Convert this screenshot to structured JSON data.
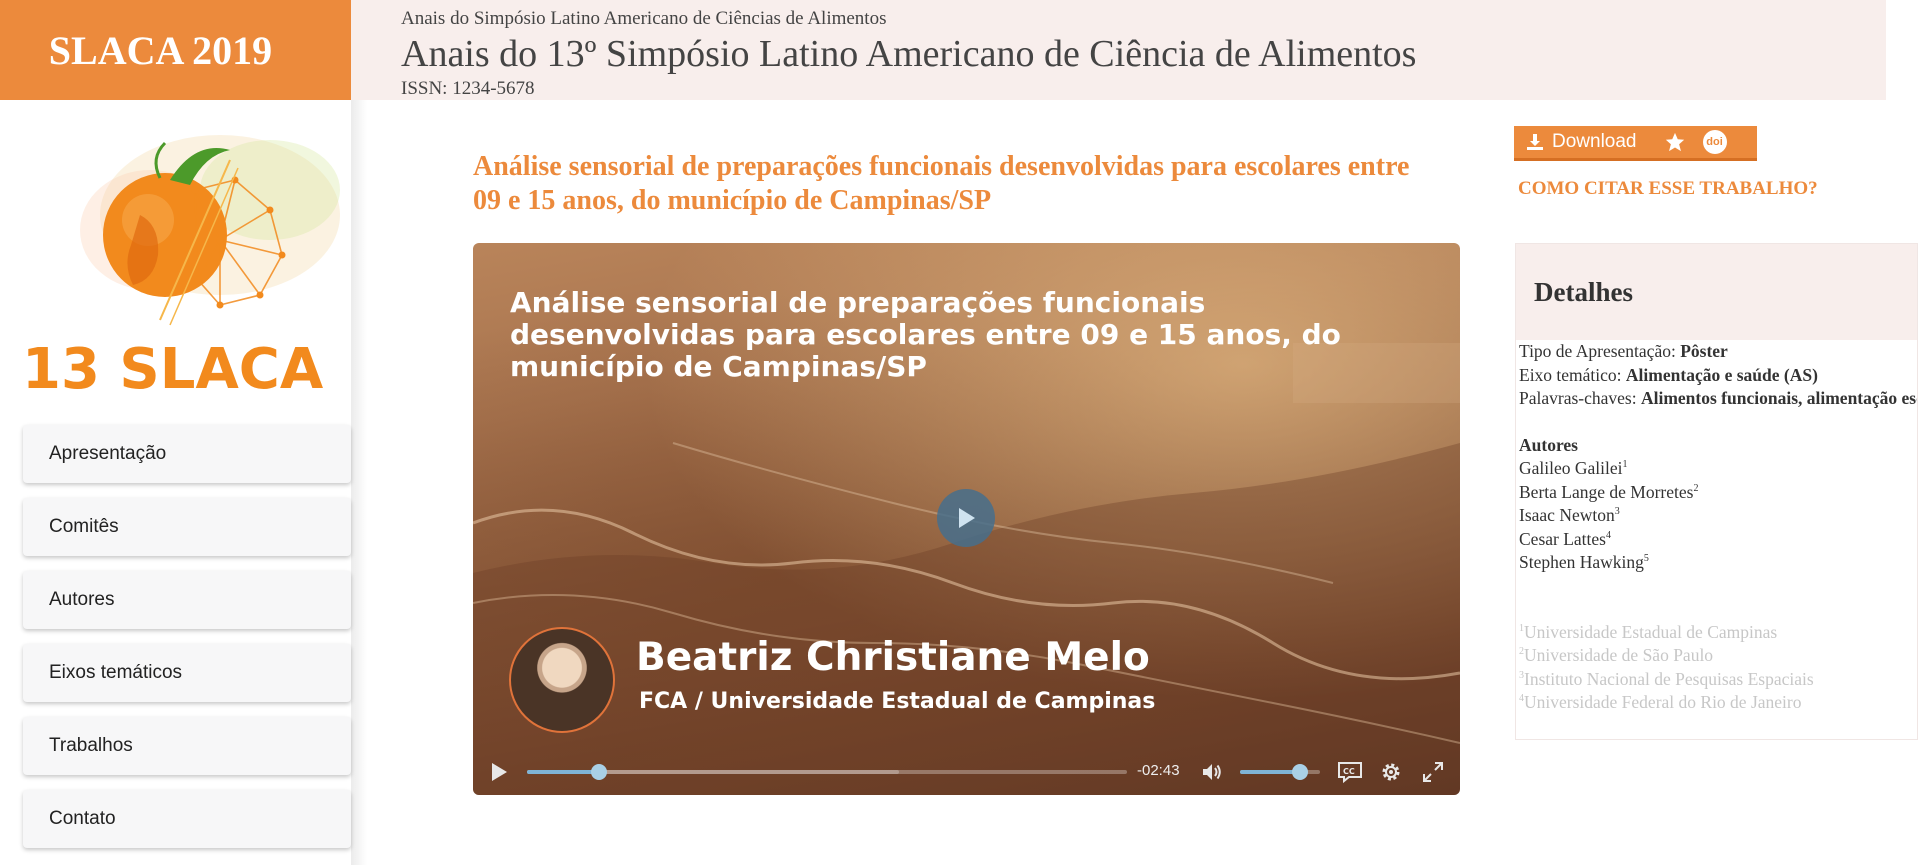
{
  "sidebar": {
    "brand": "SLACA 2019",
    "logo_text": "13 SLACA",
    "nav": [
      "Apresentação",
      "Comitês",
      "Autores",
      "Eixos temáticos",
      "Trabalhos",
      "Contato"
    ]
  },
  "header": {
    "kicker": "Anais do Simpósio Latino Americano de Ciências de Alimentos",
    "title": "Anais do 13º Simpósio Latino Americano de Ciência de Alimentos",
    "issn": "ISSN: 1234-5678"
  },
  "article": {
    "title": "Análise sensorial de preparações funcionais desenvolvidas para escolares entre 09 e 15 anos, do município de Campinas/SP"
  },
  "video": {
    "overlay_title": "Análise sensorial de preparações funcionais desenvolvidas para escolares entre 09 e 15 anos, do município de Campinas/SP",
    "presenter_name": "Beatriz Christiane Melo",
    "presenter_affiliation": "FCA / Universidade Estadual de Campinas",
    "time_remaining": "-02:43",
    "progress_fraction": 0.12,
    "buffered_fraction": 0.62,
    "volume_fraction": 0.75
  },
  "actions": {
    "download_label": "Download",
    "doi_label": "doi",
    "cite_link": "COMO CITAR ESSE TRABALHO?"
  },
  "details": {
    "heading": "Detalhes",
    "rows": [
      {
        "label": "Tipo de Apresentação: ",
        "value": "Pôster"
      },
      {
        "label": "Eixo temático: ",
        "value": "Alimentação e saúde (AS)"
      },
      {
        "label": "Palavras-chaves: ",
        "value": "Alimentos funcionais, alimentação escolar"
      }
    ],
    "authors_heading": "Autores",
    "authors": [
      {
        "name": "Galileo Galilei",
        "sup": "1"
      },
      {
        "name": "Berta Lange de Morretes",
        "sup": "2"
      },
      {
        "name": "Isaac Newton",
        "sup": "3"
      },
      {
        "name": "Cesar Lattes",
        "sup": "4"
      },
      {
        "name": "Stephen Hawking",
        "sup": "5"
      }
    ],
    "affiliations": [
      {
        "sup": "1",
        "name": "Universidade Estadual de Campinas"
      },
      {
        "sup": "2",
        "name": "Universidade de São Paulo"
      },
      {
        "sup": "3",
        "name": "Instituto Nacional de Pesquisas Espaciais"
      },
      {
        "sup": "4",
        "name": "Universidade Federal do Rio de Janeiro"
      }
    ]
  },
  "colors": {
    "accent": "#ec8a3c",
    "header_bg": "#f8eeec",
    "player_accent": "#7fb4d6"
  }
}
